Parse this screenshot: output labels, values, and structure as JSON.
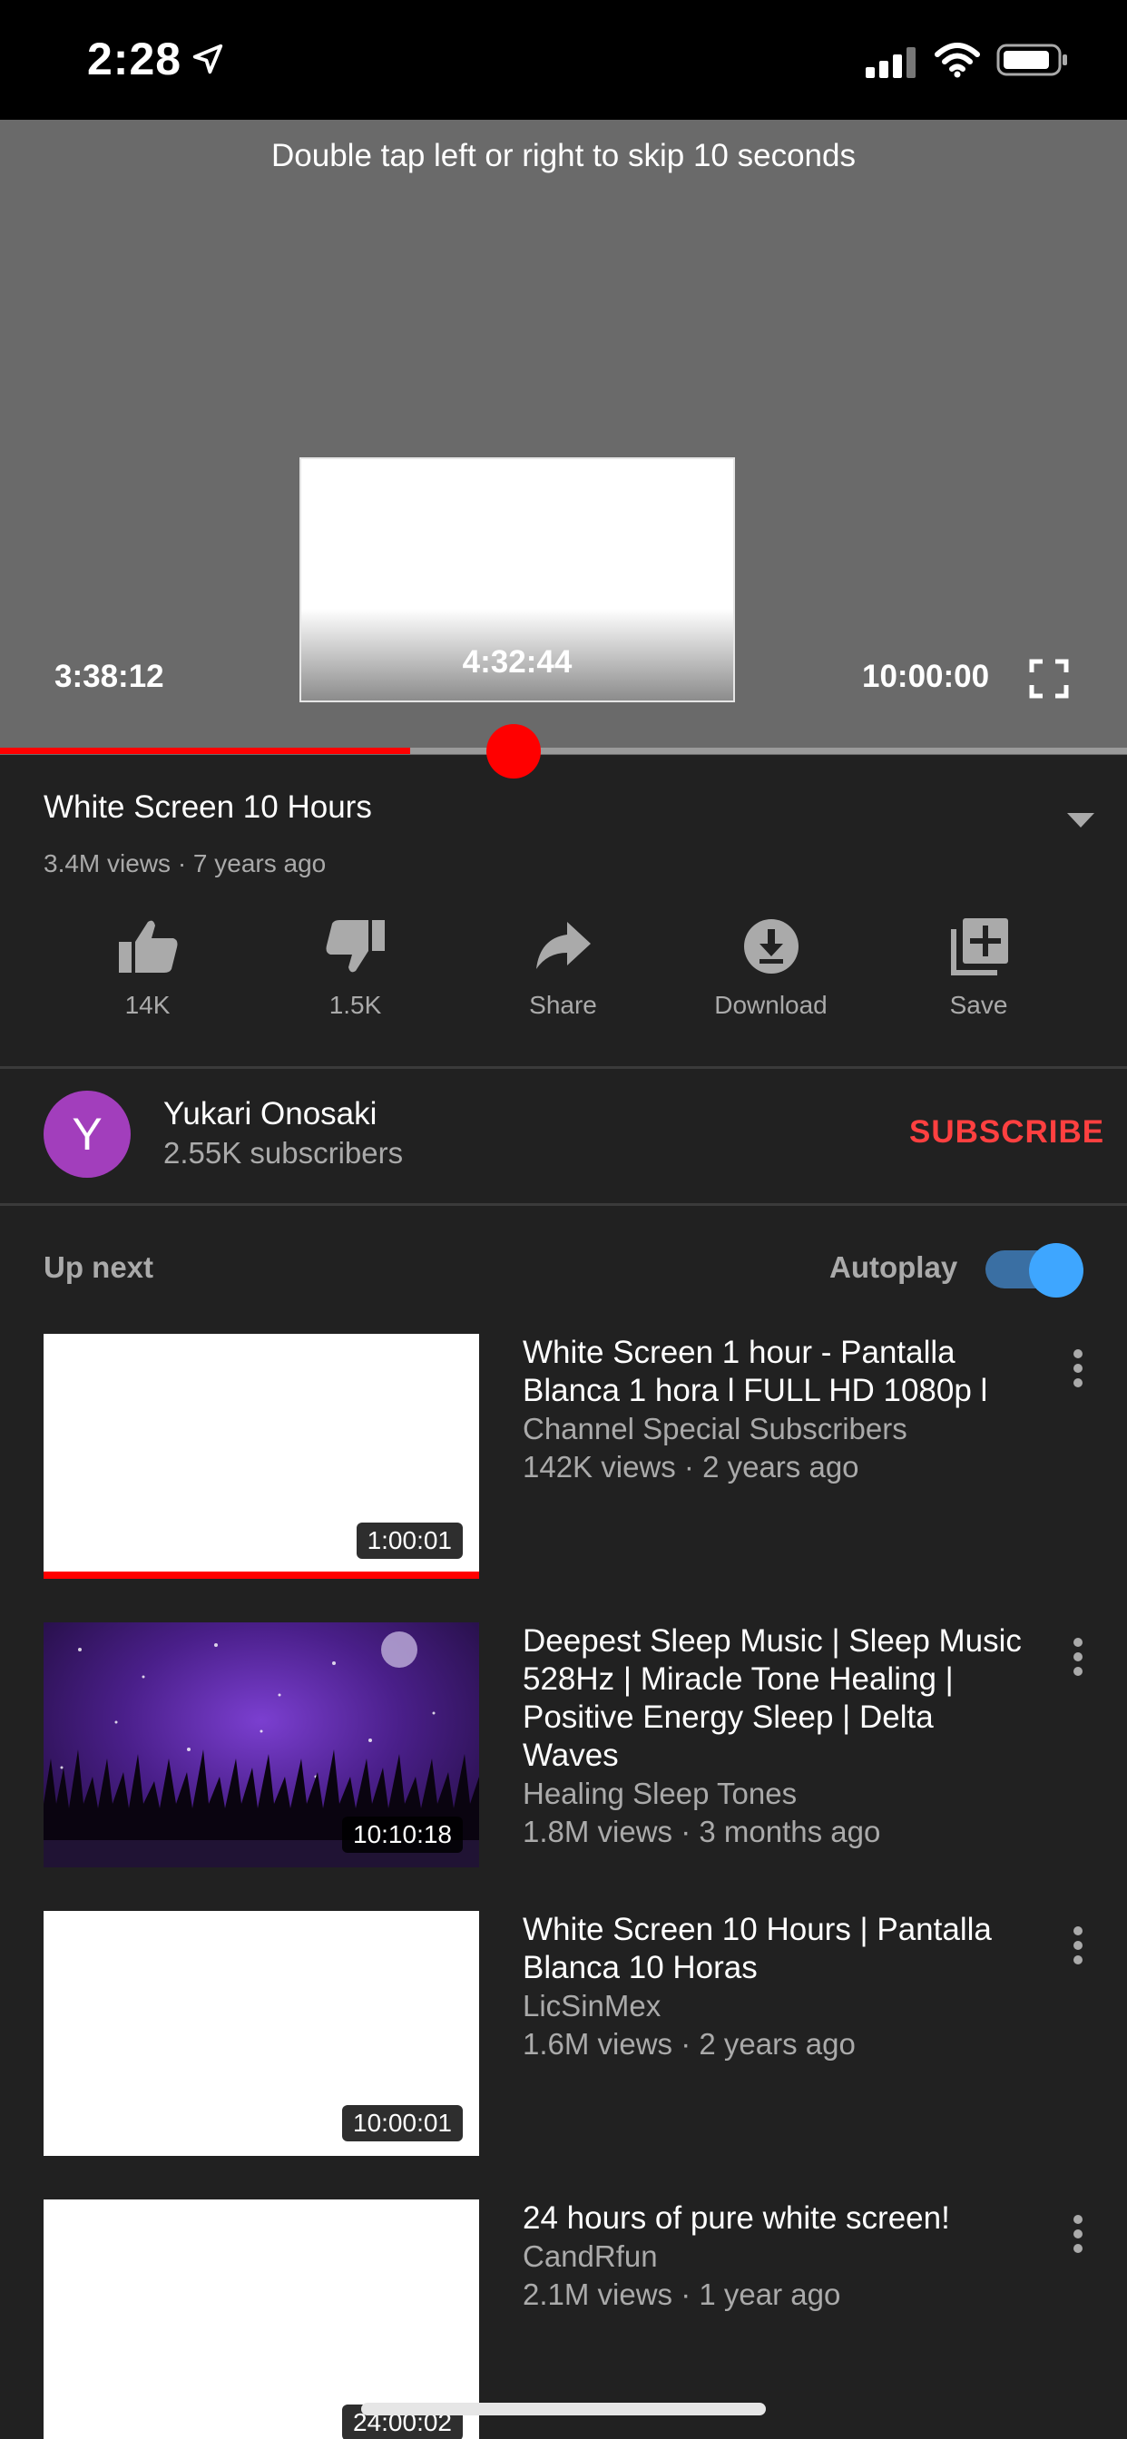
{
  "status_bar": {
    "time": "2:28"
  },
  "player": {
    "hint": "Double tap left or right to skip 10 seconds",
    "preview_time": "4:32:44",
    "current_time": "3:38:12",
    "total_time": "10:00:00",
    "progress_fraction": 0.364,
    "accent": "#ff0000"
  },
  "video": {
    "title": "White Screen 10 Hours",
    "meta": "3.4M views · 7 years ago",
    "actions": [
      {
        "icon": "thumbs-up-icon",
        "label": "14K"
      },
      {
        "icon": "thumbs-down-icon",
        "label": "1.5K"
      },
      {
        "icon": "share-icon",
        "label": "Share"
      },
      {
        "icon": "download-icon",
        "label": "Download"
      },
      {
        "icon": "save-playlist-icon",
        "label": "Save"
      }
    ]
  },
  "channel": {
    "avatar_letter": "Y",
    "avatar_color": "#a23ebc",
    "name": "Yukari Onosaki",
    "subscribers": "2.55K subscribers",
    "subscribe_label": "SUBSCRIBE"
  },
  "up_next": {
    "heading": "Up next",
    "autoplay_label": "Autoplay",
    "autoplay_on": true,
    "items": [
      {
        "title_line1": "White Screen 1 hour - Pantalla",
        "title_line2": "Blanca 1 hora l FULL HD 1080p l",
        "title_line3": "",
        "channel": "Channel Special Subscribers",
        "meta": "142K views · 2 years ago",
        "duration": "1:00:01",
        "watched": true
      },
      {
        "title_line1": "Deepest Sleep Music | Sleep Music",
        "title_line2": "528Hz | Miracle Tone Healing |",
        "title_line3": "Positive Energy Sleep | Delta Waves",
        "channel": "Healing Sleep Tones",
        "meta": "1.8M views · 3 months ago",
        "duration": "10:10:18",
        "watched": false
      },
      {
        "title_line1": "White Screen 10 Hours | Pantalla",
        "title_line2": "Blanca 10 Horas",
        "title_line3": "",
        "channel": "LicSinMex",
        "meta": "1.6M views · 2 years ago",
        "duration": "10:00:01",
        "watched": false
      },
      {
        "title_line1": "24 hours of pure white screen!",
        "title_line2": "",
        "title_line3": "",
        "channel": "CandRfun",
        "meta": "2.1M views · 1 year ago",
        "duration": "24:00:02",
        "watched": false
      }
    ]
  }
}
